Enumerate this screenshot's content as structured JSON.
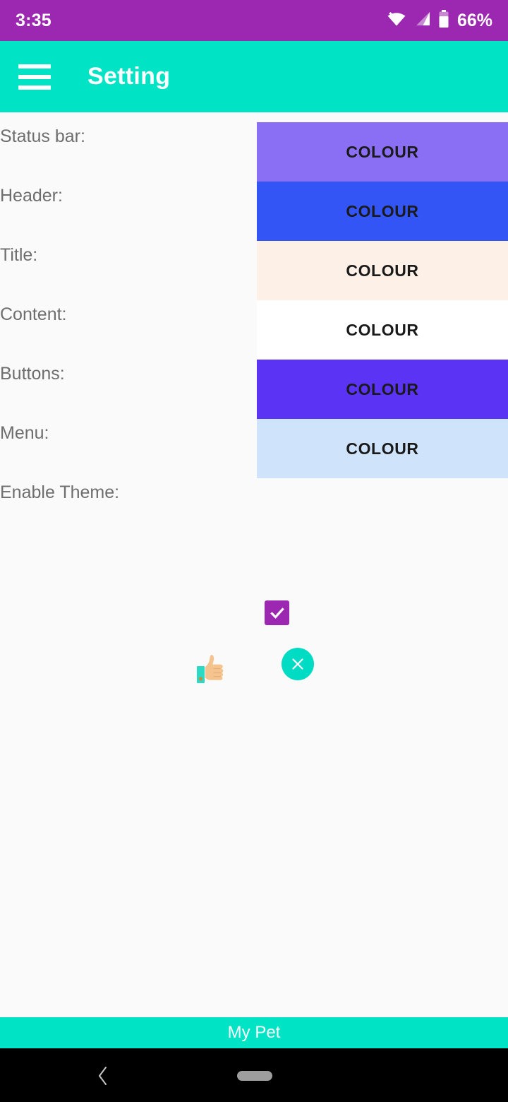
{
  "status_bar": {
    "clock": "3:35",
    "battery_percent": "66%",
    "wifi_icon": "wifi-icon",
    "signal_icon": "cellular-signal-icon",
    "battery_icon": "battery-icon",
    "background_color": "#9C27B0"
  },
  "app_bar": {
    "menu_icon": "hamburger-menu-icon",
    "title": "Setting",
    "background_color": "#00E3C4",
    "text_color": "#FFFFFF"
  },
  "settings": {
    "rows": [
      {
        "label": "Status bar:",
        "button_label": "COLOUR",
        "swatch_color": "#8A6FF5",
        "text_color": "#1A1A1A"
      },
      {
        "label": "Header:",
        "button_label": "COLOUR",
        "swatch_color": "#3355F5",
        "text_color": "#1A1A1A"
      },
      {
        "label": "Title:",
        "button_label": "COLOUR",
        "swatch_color": "#FDF0E6",
        "text_color": "#1A1A1A"
      },
      {
        "label": "Content:",
        "button_label": "COLOUR",
        "swatch_color": "#FFFFFF",
        "text_color": "#1A1A1A"
      },
      {
        "label": "Buttons:",
        "button_label": "COLOUR",
        "swatch_color": "#5A33F5",
        "text_color": "#1A1A1A"
      },
      {
        "label": "Menu:",
        "button_label": "COLOUR",
        "swatch_color": "#CFE4FB",
        "text_color": "#1A1A1A"
      }
    ],
    "enable_theme": {
      "label": "Enable Theme:",
      "checked": true,
      "checkbox_color": "#9C27B0",
      "check_color": "#FFFFFF"
    }
  },
  "actions": {
    "confirm": {
      "icon": "thumbs-up-icon",
      "sleeve_color": "#2BD9C5",
      "skin_color": "#F5CA9C"
    },
    "cancel": {
      "icon": "close-x-icon",
      "background_color": "#00DBC4",
      "icon_color": "#FFFFFF"
    }
  },
  "bottom_bar": {
    "label": "My Pet",
    "background_color": "#00E3C4",
    "text_color": "#FFFFFF"
  },
  "nav_bar": {
    "back_icon": "chevron-left-icon",
    "home_pill_icon": "home-pill-icon",
    "background_color": "#000000"
  }
}
